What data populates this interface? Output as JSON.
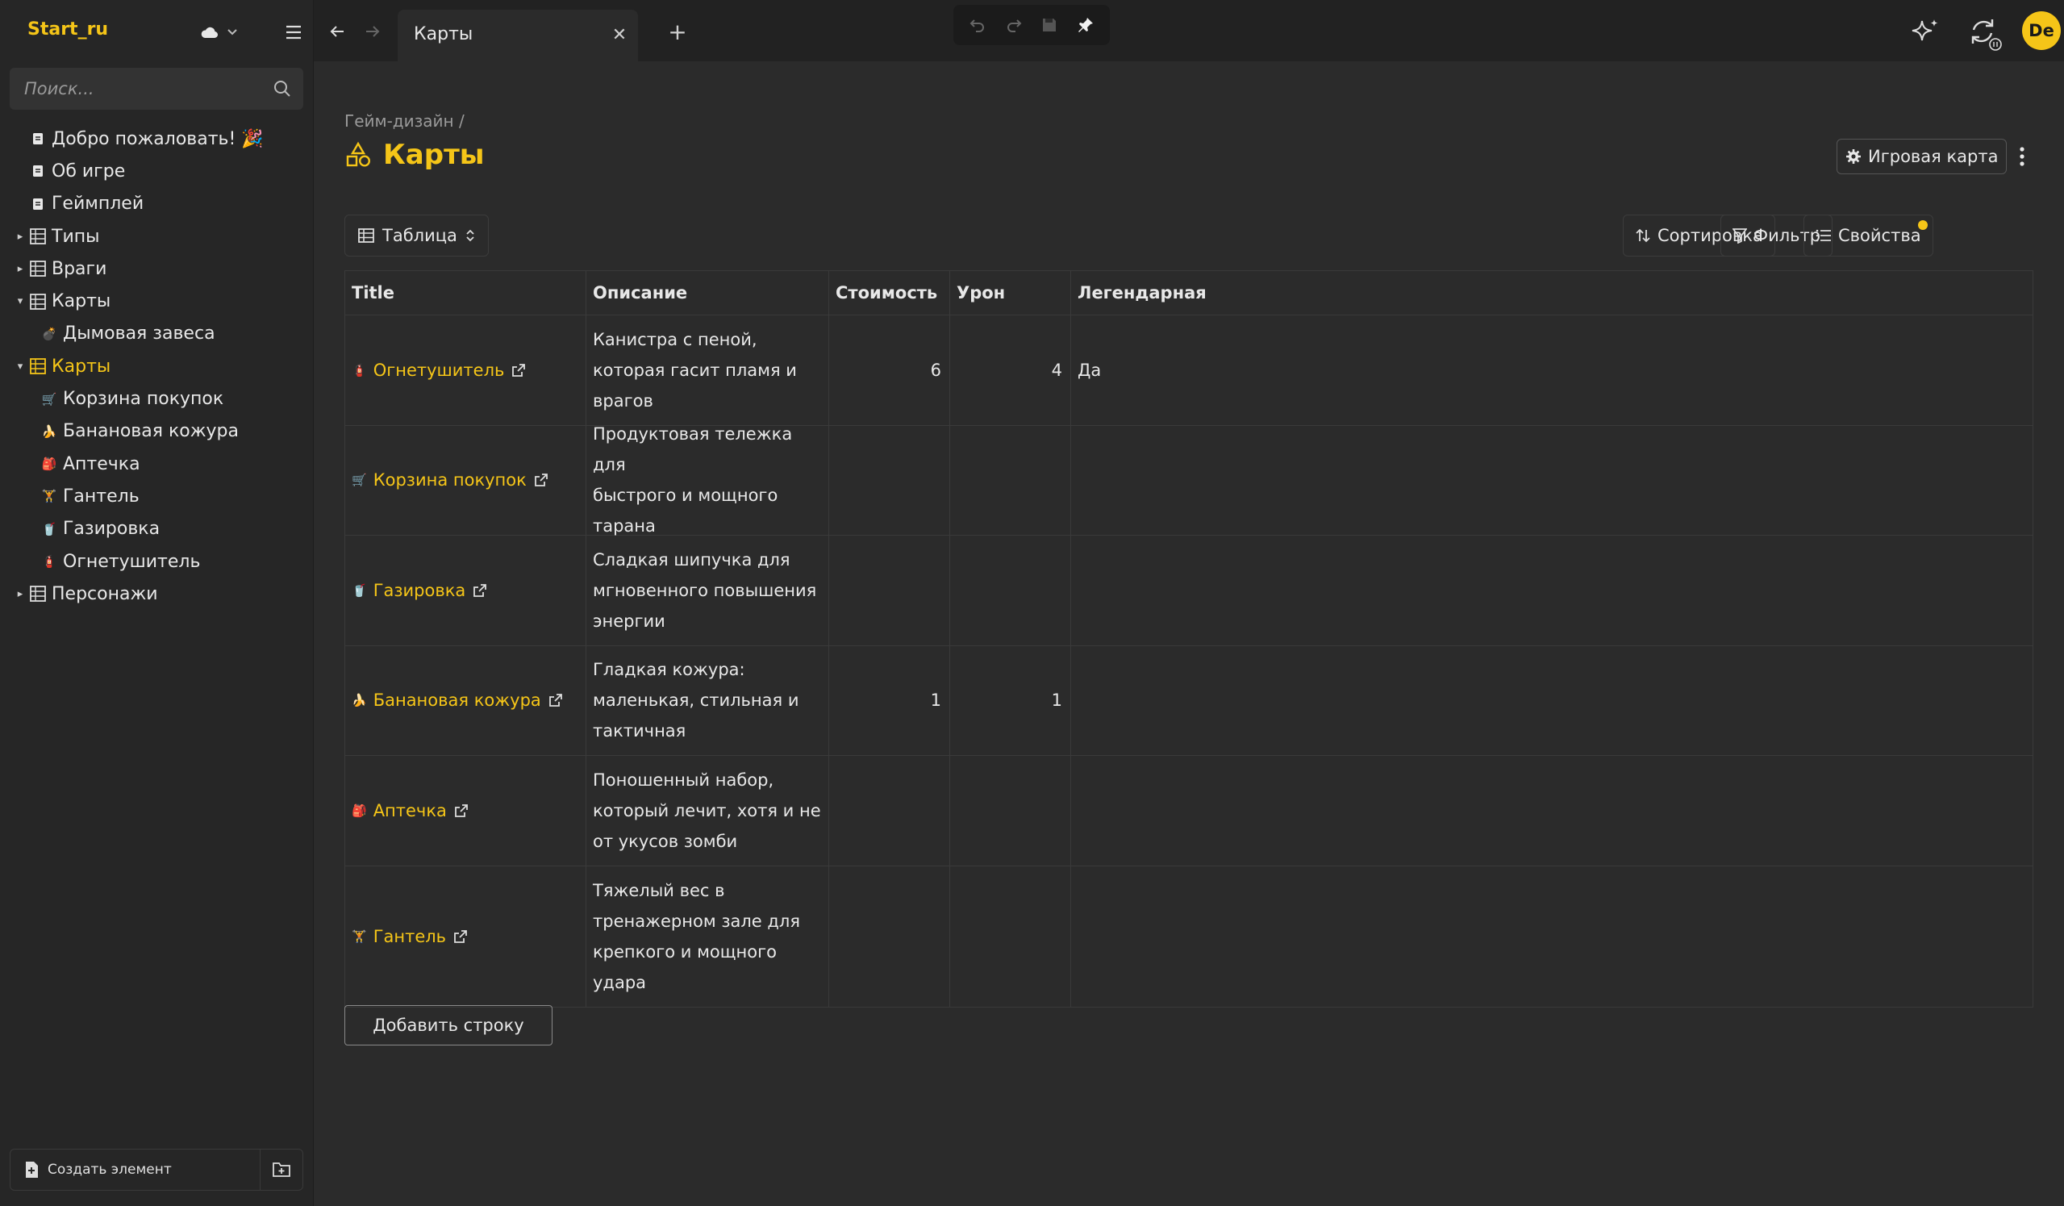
{
  "app": {
    "name": "Start_ru"
  },
  "colors": {
    "accent": "#f5c518",
    "background": "#2b2b2b",
    "sidebar": "#262626"
  },
  "search": {
    "placeholder": "Поиск..."
  },
  "tree": [
    {
      "label": "Добро пожаловать! 🎉",
      "icon": "page-icon",
      "level": 0,
      "caret": ""
    },
    {
      "label": "Об игре",
      "icon": "page-icon",
      "level": 0,
      "caret": ""
    },
    {
      "label": "Геймплей",
      "icon": "page-icon",
      "level": 0,
      "caret": ""
    },
    {
      "label": "Типы",
      "icon": "database-icon",
      "level": 0,
      "caret": "▸"
    },
    {
      "label": "Враги",
      "icon": "database-icon",
      "level": 0,
      "caret": "▸"
    },
    {
      "label": "Карты",
      "icon": "database-icon",
      "level": 0,
      "caret": "▾"
    },
    {
      "label": "Дымовая завеса",
      "icon": "item-icon",
      "level": 1,
      "caret": ""
    },
    {
      "label": "Карты",
      "icon": "database-icon",
      "level": 0,
      "caret": "▾",
      "active": true
    },
    {
      "label": "Корзина покупок",
      "icon": "item-icon",
      "level": 1,
      "caret": ""
    },
    {
      "label": "Банановая кожура",
      "icon": "item-icon",
      "level": 1,
      "caret": ""
    },
    {
      "label": "Аптечка",
      "icon": "item-icon",
      "level": 1,
      "caret": ""
    },
    {
      "label": "Гантель",
      "icon": "item-icon",
      "level": 1,
      "caret": ""
    },
    {
      "label": "Газировка",
      "icon": "item-icon",
      "level": 1,
      "caret": ""
    },
    {
      "label": "Огнетушитель",
      "icon": "item-icon",
      "level": 1,
      "caret": ""
    },
    {
      "label": "Персонажи",
      "icon": "database-icon",
      "level": 0,
      "caret": "▸"
    }
  ],
  "sidebar_footer": {
    "create_label": "Создать элемент"
  },
  "tab": {
    "title": "Карты"
  },
  "page": {
    "breadcrumb": "Гейм-дизайн /",
    "title": "Карты",
    "game_map_label": "Игровая карта",
    "view_label": "Таблица",
    "sort_label": "Сортировка",
    "filter_label": "Фильтр",
    "props_label": "Свойства",
    "add_row_label": "Добавить строку"
  },
  "table": {
    "headers": [
      "Title",
      "Описание",
      "Стоимость",
      "Урон",
      "Легендарная"
    ],
    "rows": [
      {
        "title": "Огнетушитель",
        "desc": [
          "Канистра с пеной,",
          "которая гасит пламя и",
          "врагов"
        ],
        "cost": "6",
        "damage": "4",
        "legendary": "Да"
      },
      {
        "title": "Корзина покупок",
        "desc": [
          "Продуктовая тележка для",
          "быстрого и мощного",
          "тарана"
        ],
        "cost": "",
        "damage": "",
        "legendary": ""
      },
      {
        "title": "Газировка",
        "desc": [
          "Сладкая шипучка для",
          "мгновенного повышения",
          "энергии"
        ],
        "cost": "",
        "damage": "",
        "legendary": ""
      },
      {
        "title": "Банановая кожура",
        "desc": [
          "Гладкая кожура:",
          "маленькая, стильная и",
          "тактичная"
        ],
        "cost": "1",
        "damage": "1",
        "legendary": ""
      },
      {
        "title": "Аптечка",
        "desc": [
          "Поношенный набор,",
          "который лечит, хотя и не",
          "от укусов зомби"
        ],
        "cost": "",
        "damage": "",
        "legendary": ""
      },
      {
        "title": "Гантель",
        "desc": [
          "Тяжелый вес в",
          "тренажерном зале для",
          "крепкого и мощного",
          "удара"
        ],
        "cost": "",
        "damage": "",
        "legendary": ""
      }
    ]
  }
}
